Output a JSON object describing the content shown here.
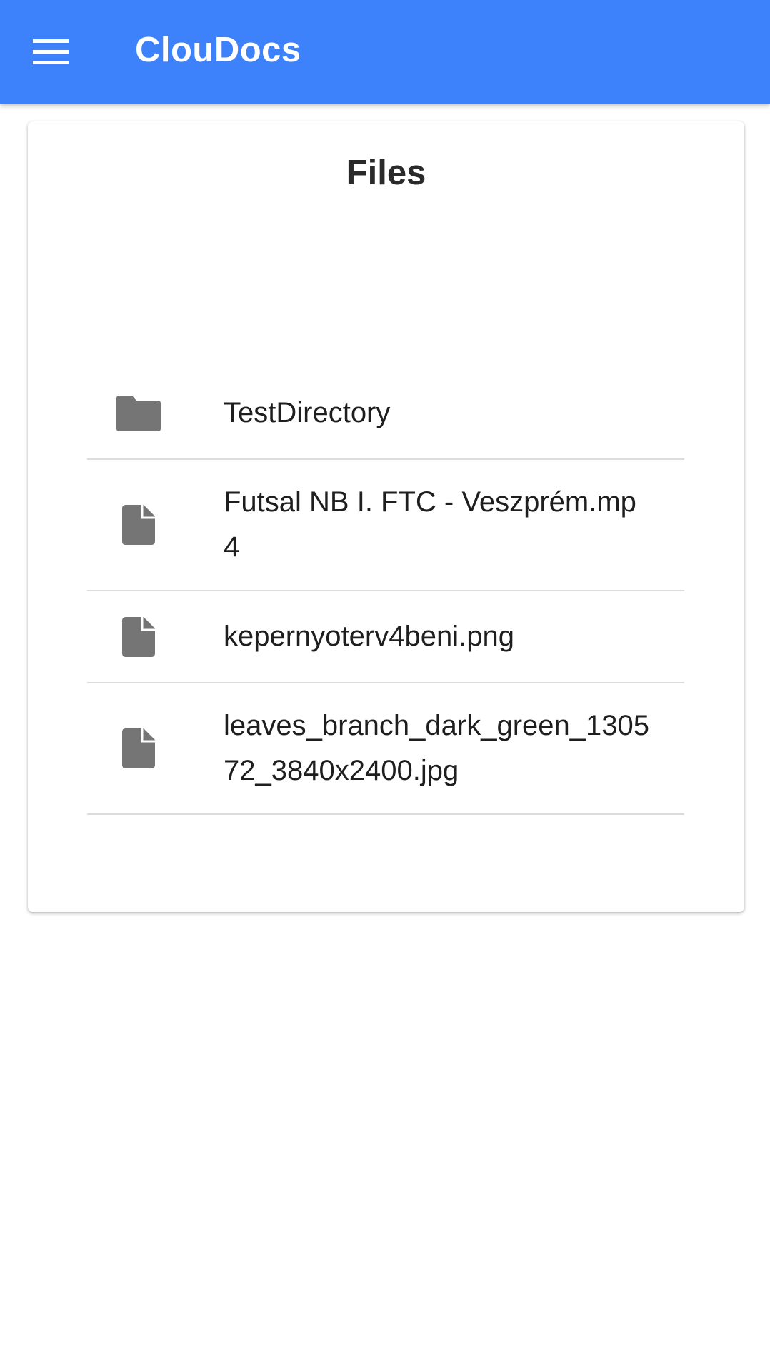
{
  "appbar": {
    "title": "ClouDocs",
    "menu_icon": "hamburger-menu-icon",
    "color": "#3d82fb"
  },
  "card": {
    "title": "Files"
  },
  "files": [
    {
      "name": "TestDirectory",
      "type": "folder",
      "icon": "folder-icon"
    },
    {
      "name": "Futsal NB I. FTC - Veszprém.mp4",
      "type": "file",
      "icon": "file-icon"
    },
    {
      "name": "kepernyoterv4beni.png",
      "type": "file",
      "icon": "file-icon"
    },
    {
      "name": "leaves_branch_dark_green_130572_3840x2400.jpg",
      "type": "file",
      "icon": "file-icon"
    }
  ]
}
